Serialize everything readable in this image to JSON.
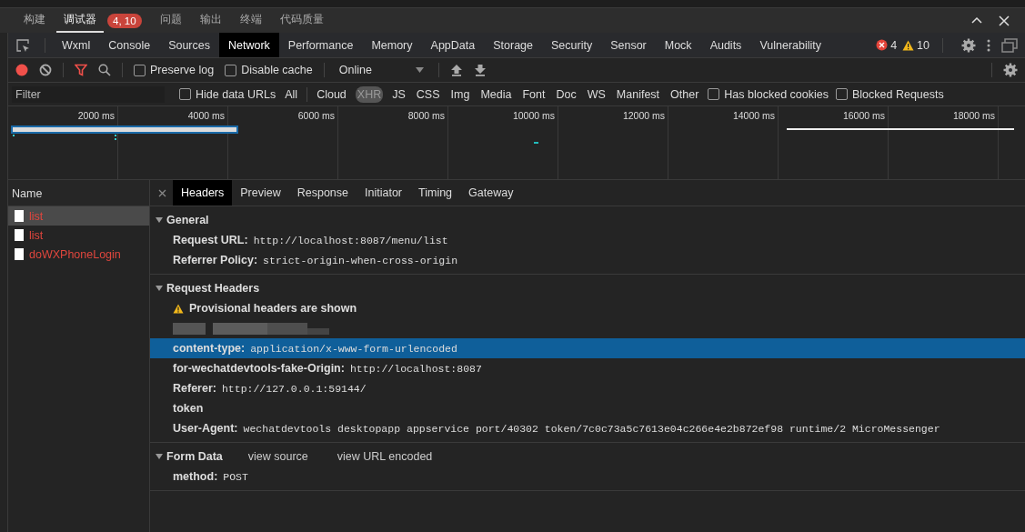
{
  "panel_tabs": [
    {
      "label": "构建",
      "selected": false
    },
    {
      "label": "调试器",
      "selected": true,
      "badge": "4, 10"
    },
    {
      "label": "问题",
      "selected": false
    },
    {
      "label": "输出",
      "selected": false
    },
    {
      "label": "终端",
      "selected": false
    },
    {
      "label": "代码质量",
      "selected": false
    }
  ],
  "devtools_tabs": [
    {
      "label": "Wxml",
      "selected": false
    },
    {
      "label": "Console",
      "selected": false
    },
    {
      "label": "Sources",
      "selected": false
    },
    {
      "label": "Network",
      "selected": true
    },
    {
      "label": "Performance",
      "selected": false
    },
    {
      "label": "Memory",
      "selected": false
    },
    {
      "label": "AppData",
      "selected": false
    },
    {
      "label": "Storage",
      "selected": false
    },
    {
      "label": "Security",
      "selected": false
    },
    {
      "label": "Sensor",
      "selected": false
    },
    {
      "label": "Mock",
      "selected": false
    },
    {
      "label": "Audits",
      "selected": false
    },
    {
      "label": "Vulnerability",
      "selected": false
    }
  ],
  "issue_counts": {
    "errors": "4",
    "warnings": "10"
  },
  "toolbar": {
    "recording": true,
    "preserve_log": {
      "label": "Preserve log",
      "checked": false
    },
    "disable_cache": {
      "label": "Disable cache",
      "checked": false
    },
    "throttling": "Online"
  },
  "filter": {
    "placeholder": "Filter",
    "hide_data_urls": {
      "label": "Hide data URLs",
      "checked": false
    },
    "types": [
      {
        "label": "All",
        "selected": false
      },
      {
        "label": "Cloud",
        "selected": false
      },
      {
        "label": "XHR",
        "selected": true
      },
      {
        "label": "JS",
        "selected": false
      },
      {
        "label": "CSS",
        "selected": false
      },
      {
        "label": "Img",
        "selected": false
      },
      {
        "label": "Media",
        "selected": false
      },
      {
        "label": "Font",
        "selected": false
      },
      {
        "label": "Doc",
        "selected": false
      },
      {
        "label": "WS",
        "selected": false
      },
      {
        "label": "Manifest",
        "selected": false
      },
      {
        "label": "Other",
        "selected": false
      }
    ],
    "has_blocked_cookies": {
      "label": "Has blocked cookies",
      "checked": false
    },
    "blocked_requests": {
      "label": "Blocked Requests",
      "checked": false
    }
  },
  "timeline": {
    "ticks": [
      "2000 ms",
      "4000 ms",
      "6000 ms",
      "8000 ms",
      "10000 ms",
      "12000 ms",
      "14000 ms",
      "16000 ms",
      "18000 ms"
    ]
  },
  "requests": {
    "column": "Name",
    "rows": [
      {
        "name": "list",
        "selected": true,
        "failed": true
      },
      {
        "name": "list",
        "selected": false,
        "failed": true
      },
      {
        "name": "doWXPhoneLogin",
        "selected": false,
        "failed": true
      }
    ]
  },
  "detail_tabs": [
    {
      "label": "Headers",
      "selected": true
    },
    {
      "label": "Preview",
      "selected": false
    },
    {
      "label": "Response",
      "selected": false
    },
    {
      "label": "Initiator",
      "selected": false
    },
    {
      "label": "Timing",
      "selected": false
    },
    {
      "label": "Gateway",
      "selected": false
    }
  ],
  "sections": [
    {
      "title": "General",
      "expanded": true,
      "rows": [
        {
          "kind": "header",
          "key": "Request URL:",
          "value": "http://localhost:8087/menu/list",
          "selected": false
        },
        {
          "kind": "header",
          "key": "Referrer Policy:",
          "value": "strict-origin-when-cross-origin",
          "selected": false
        }
      ]
    },
    {
      "title": "Request Headers",
      "expanded": true,
      "warning": "Provisional headers are shown",
      "rows": [
        {
          "kind": "redacted",
          "selected": false
        },
        {
          "kind": "header",
          "key": "content-type:",
          "value": "application/x-www-form-urlencoded",
          "selected": true
        },
        {
          "kind": "header",
          "key": "for-wechatdevtools-fake-Origin:",
          "value": "http://localhost:8087",
          "selected": false
        },
        {
          "kind": "header",
          "key": "Referer:",
          "value": "http://127.0.0.1:59144/",
          "selected": false
        },
        {
          "kind": "header",
          "key": "token",
          "selected": false
        },
        {
          "kind": "header",
          "key": "User-Agent:",
          "value": "wechatdevtools desktopapp appservice port/40302 token/7c0c73a5c7613e04c266e4e2b872ef98 runtime/2 MicroMessenger",
          "selected": false
        }
      ]
    },
    {
      "title": "Form Data",
      "expanded": true,
      "links": [
        "view source",
        "view URL encoded"
      ],
      "rows": [
        {
          "kind": "header",
          "key": "method:",
          "value": "POST",
          "selected": false
        }
      ]
    }
  ]
}
